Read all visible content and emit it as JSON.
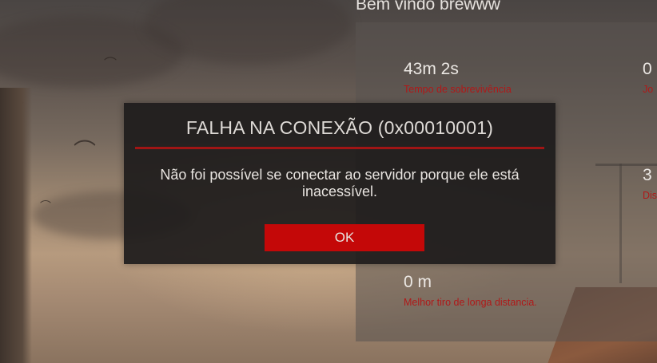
{
  "header": {
    "welcome_text": "Bem vindo brewww"
  },
  "stats": {
    "survival_time": {
      "value": "43m 2s",
      "label": "Tempo de sobrevivência"
    },
    "right_top": {
      "value": "0",
      "label": "Jo"
    },
    "right_mid": {
      "value": "3",
      "label": "Dis"
    },
    "long_shot": {
      "value": "0 m",
      "label": "Melhor tiro de longa distancia."
    }
  },
  "dialog": {
    "title": "FALHA NA CONEXÃO (0x00010001)",
    "message": "Não foi possível se conectar ao servidor porque ele está inacessível.",
    "ok_label": "OK"
  },
  "colors": {
    "accent_red": "#c40808",
    "label_red": "#b01818",
    "modal_bg": "#1e1c1c"
  }
}
